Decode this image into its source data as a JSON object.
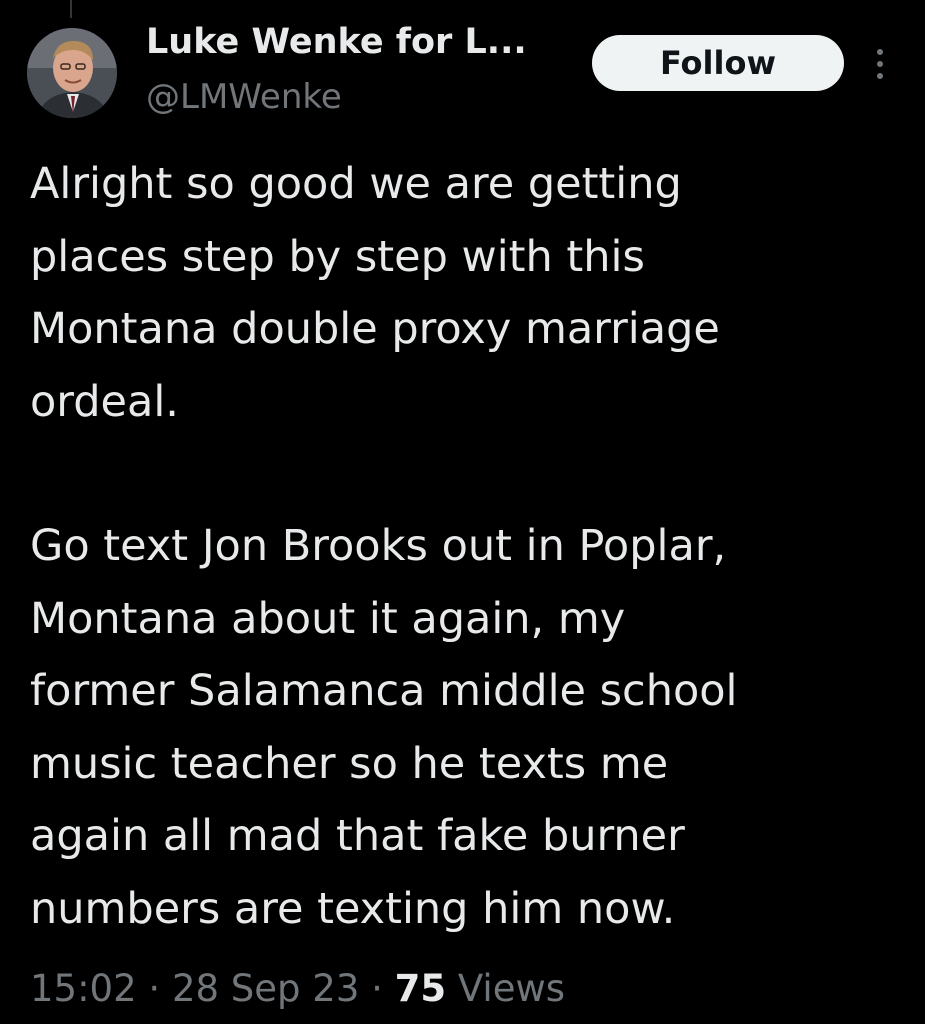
{
  "author": {
    "display_name": "Luke Wenke for L...",
    "handle": "@LMWenke",
    "avatar_icon": "user-avatar-photo"
  },
  "actions": {
    "follow_label": "Follow",
    "more_icon": "more-options-icon"
  },
  "tweet": {
    "paragraph1_lines": [
      "Alright so good we are getting",
      "places step by step with this",
      "Montana double proxy marriage",
      "ordeal."
    ],
    "paragraph2_lines": [
      "Go text Jon Brooks out in Poplar,",
      "Montana about it again, my",
      "former Salamanca middle school",
      "music teacher so he texts me",
      "again all mad that fake burner",
      "numbers are texting him now."
    ]
  },
  "meta": {
    "time": "15:02",
    "separator": "·",
    "date": "28 Sep 23",
    "views_count": "75",
    "views_label": "Views"
  },
  "colors": {
    "background": "#000000",
    "primary_text": "#e7e9ea",
    "secondary_text": "#71767b",
    "follow_bg": "#eff3f4",
    "follow_text": "#0f1419"
  }
}
